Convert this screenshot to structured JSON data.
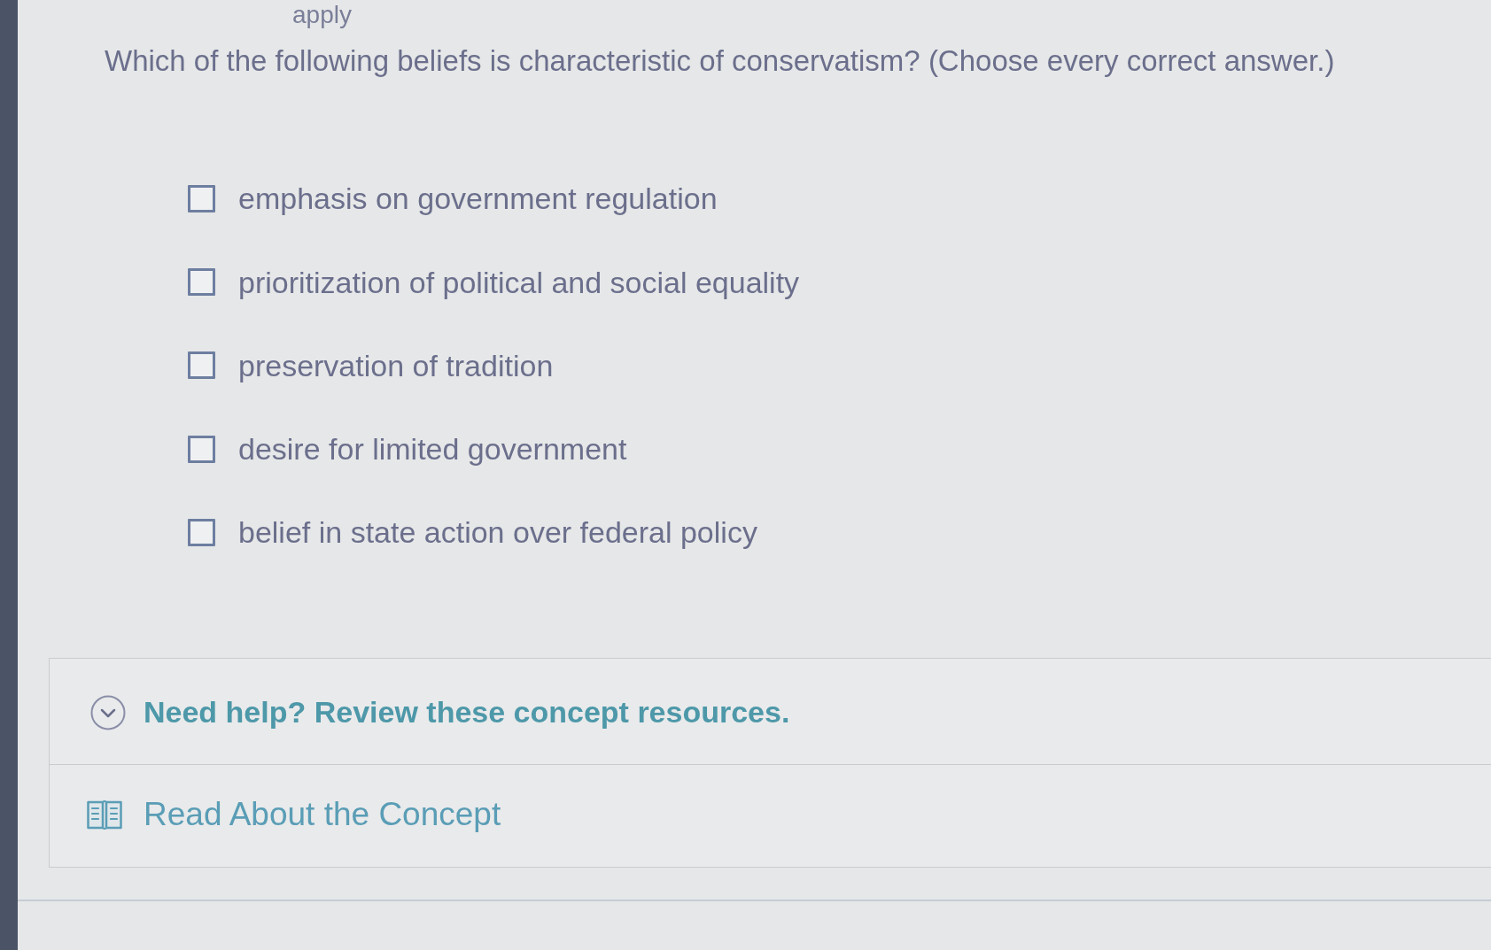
{
  "header": {
    "instruction_fragment": "apply"
  },
  "question": {
    "text": "Which of the following beliefs is characteristic of conservatism? (Choose every correct answer.)"
  },
  "options": [
    {
      "label": "emphasis on government regulation",
      "checked": false
    },
    {
      "label": "prioritization of political and social equality",
      "checked": false
    },
    {
      "label": "preservation of tradition",
      "checked": false
    },
    {
      "label": "desire for limited government",
      "checked": false
    },
    {
      "label": "belief in state action over federal policy",
      "checked": false
    }
  ],
  "help": {
    "title": "Need help? Review these concept resources.",
    "resources": [
      {
        "label": "Read About the Concept"
      }
    ]
  }
}
